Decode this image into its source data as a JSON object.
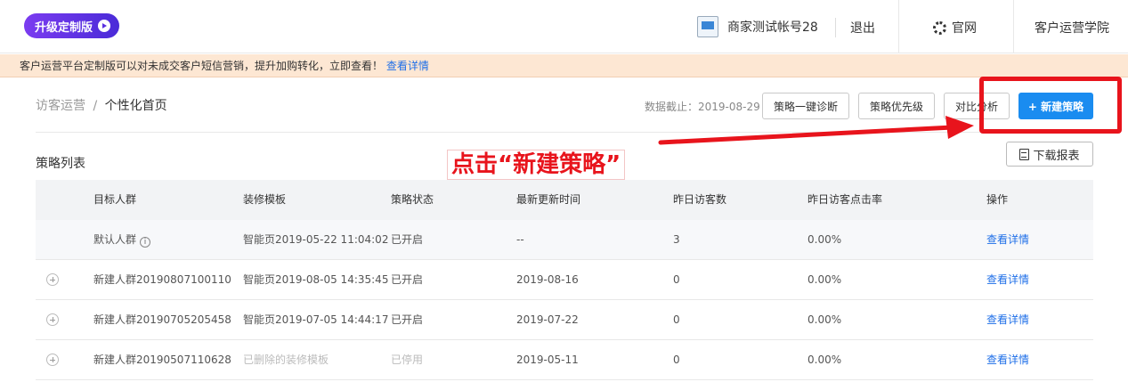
{
  "topbar": {
    "upgrade_label": "升级定制版",
    "account_name": "商家测试帐号28",
    "logout_label": "退出",
    "official_site_label": "官网",
    "academy_label": "客户运营学院"
  },
  "banner": {
    "text": "客户运营平台定制版可以对未成交客户短信营销，提升加购转化，立即查看！",
    "link": "查看详情"
  },
  "breadcrumb": {
    "parent": "访客运营",
    "separator": "/",
    "current": "个性化首页"
  },
  "toolbar": {
    "as_of": "数据截止：2019-08-29",
    "diagnose": "策略一键诊断",
    "priority": "策略优先级",
    "compare": "对比分析",
    "create": "+ 新建策略"
  },
  "annotation": {
    "text": "点击“新建策略”",
    "color": "#e8141c"
  },
  "list": {
    "title": "策略列表",
    "download": "下载报表",
    "columns": [
      "目标人群",
      "装修模板",
      "策略状态",
      "最新更新时间",
      "昨日访客数",
      "昨日访客点击率",
      "操作"
    ],
    "rows": [
      {
        "crowd": "默认人群",
        "template": "智能页2019-05-22 11:04:02",
        "status": "已开启",
        "updated": "--",
        "visitors": "3",
        "ctr": "0.00%",
        "action": "查看详情"
      },
      {
        "crowd": "新建人群20190807100110",
        "template": "智能页2019-08-05 14:35:45",
        "status": "已开启",
        "updated": "2019-08-16",
        "visitors": "0",
        "ctr": "0.00%",
        "action": "查看详情"
      },
      {
        "crowd": "新建人群20190705205458",
        "template": "智能页2019-07-05 14:44:17",
        "status": "已开启",
        "updated": "2019-07-22",
        "visitors": "0",
        "ctr": "0.00%",
        "action": "查看详情"
      },
      {
        "crowd": "新建人群20190507110628",
        "template": "已删除的装修模板",
        "status": "已停用",
        "updated": "2019-05-11",
        "visitors": "0",
        "ctr": "0.00%",
        "action": "查看详情"
      }
    ]
  }
}
